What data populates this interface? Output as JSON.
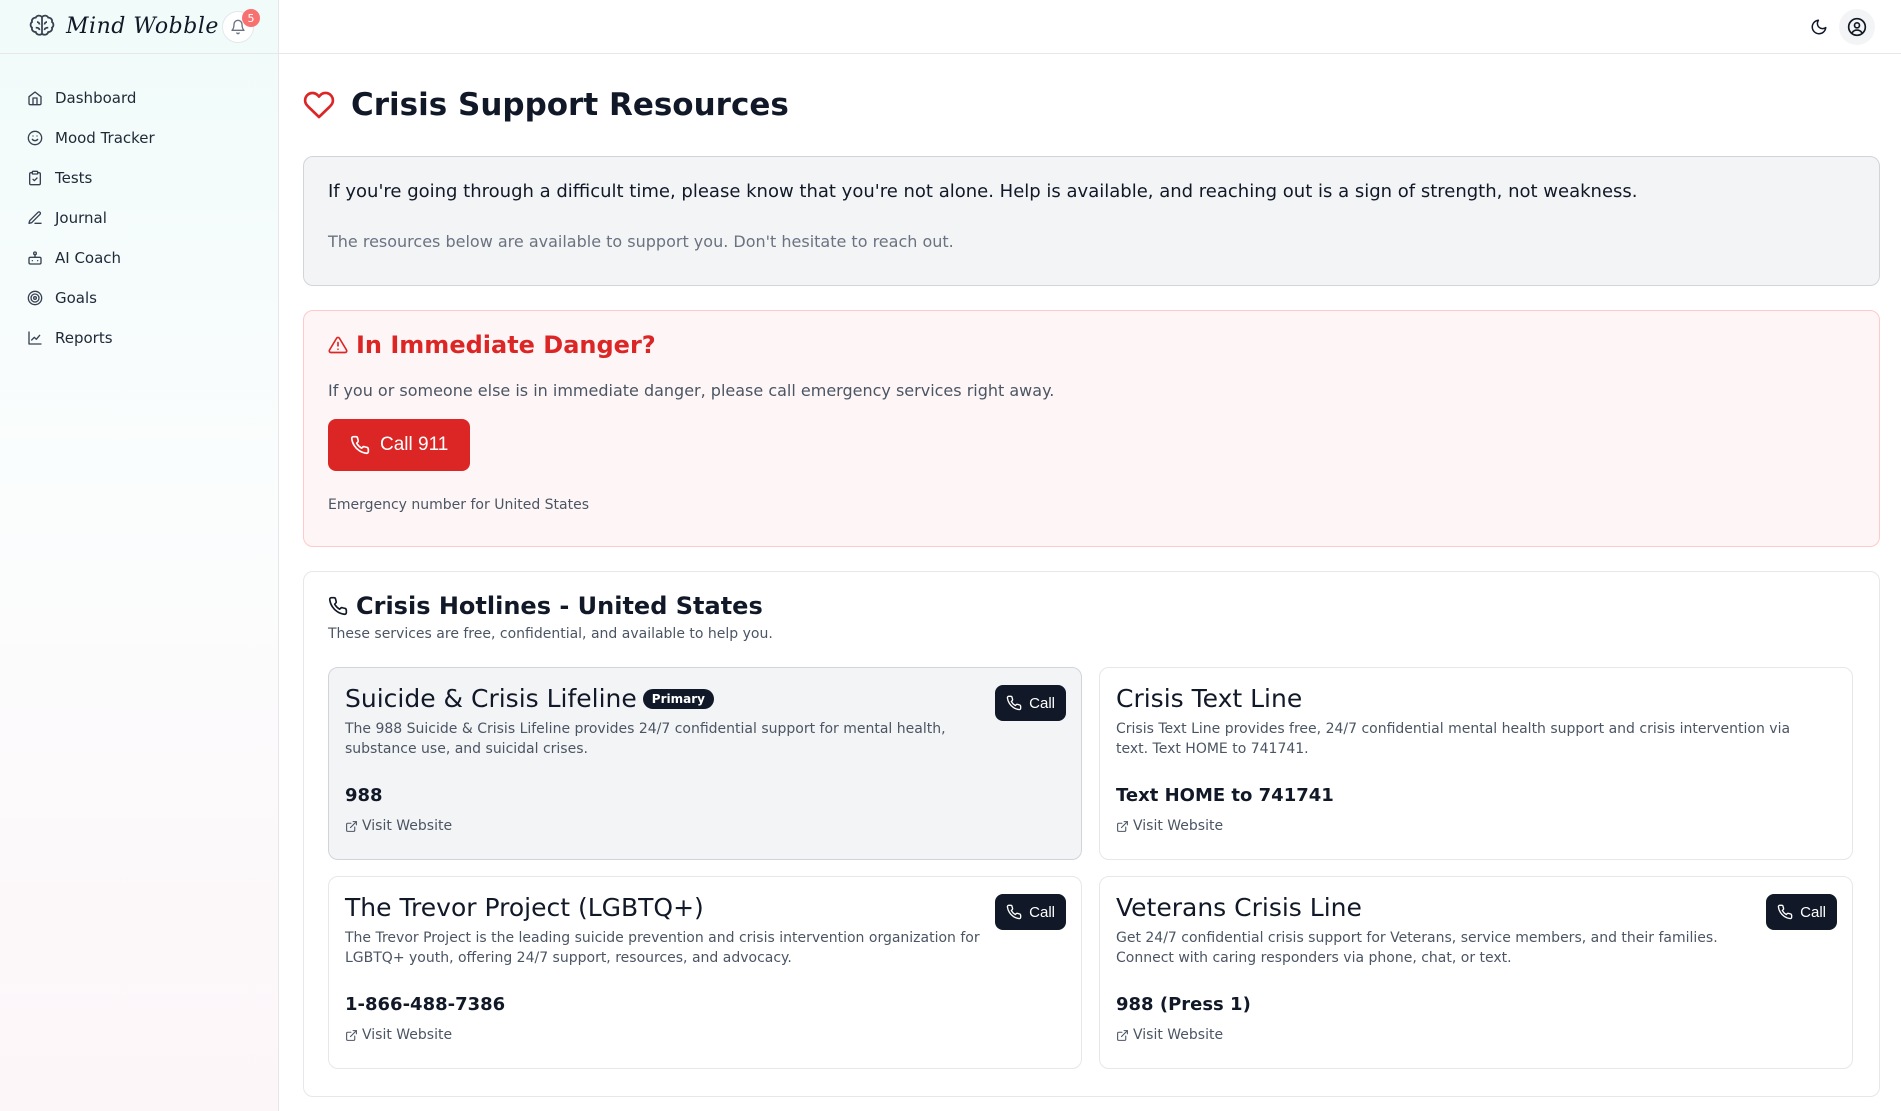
{
  "app": {
    "name": "Mind Wobble",
    "notification_count": "5"
  },
  "sidebar": {
    "items": [
      {
        "label": "Dashboard",
        "icon": "home-icon"
      },
      {
        "label": "Mood Tracker",
        "icon": "smile-icon"
      },
      {
        "label": "Tests",
        "icon": "clipboard-icon"
      },
      {
        "label": "Journal",
        "icon": "pen-icon"
      },
      {
        "label": "AI Coach",
        "icon": "bot-icon"
      },
      {
        "label": "Goals",
        "icon": "target-icon"
      },
      {
        "label": "Reports",
        "icon": "chart-line-icon"
      }
    ]
  },
  "header": {
    "theme_icon": "moon-icon",
    "user_icon": "user-circle-icon"
  },
  "page": {
    "title": "Crisis Support Resources",
    "intro_main": "If you're going through a difficult time, please know that you're not alone. Help is available, and reaching out is a sign of strength, not weakness.",
    "intro_sub": "The resources below are available to support you. Don't hesitate to reach out."
  },
  "danger": {
    "title": "In Immediate Danger?",
    "description": "If you or someone else is in immediate danger, please call emergency services right away.",
    "button_label": "Call 911",
    "note": "Emergency number for United States"
  },
  "hotlines": {
    "title": "Crisis Hotlines - United States",
    "subtitle": "These services are free, confidential, and available to help you.",
    "call_label": "Call",
    "website_label": "Visit Website",
    "items": [
      {
        "name": "Suicide & Crisis Lifeline",
        "badge": "Primary",
        "description": "The 988 Suicide & Crisis Lifeline provides 24/7 confidential support for mental health, substance use, and suicidal crises.",
        "number": "988"
      },
      {
        "name": "Crisis Text Line",
        "description": "Crisis Text Line provides free, 24/7 confidential mental health support and crisis intervention via text. Text HOME to 741741.",
        "number": "Text HOME to 741741"
      },
      {
        "name": "The Trevor Project (LGBTQ+)",
        "description": "The Trevor Project is the leading suicide prevention and crisis intervention organization for LGBTQ+ youth, offering 24/7 support, resources, and advocacy.",
        "number": "1-866-488-7386"
      },
      {
        "name": "Veterans Crisis Line",
        "description": "Get 24/7 confidential crisis support for Veterans, service members, and their families. Connect with caring responders via phone, chat, or text.",
        "number": "988 (Press 1)"
      }
    ]
  },
  "colors": {
    "danger": "#dc2626",
    "primary_dark": "#111827",
    "badge_red": "#f87171"
  }
}
